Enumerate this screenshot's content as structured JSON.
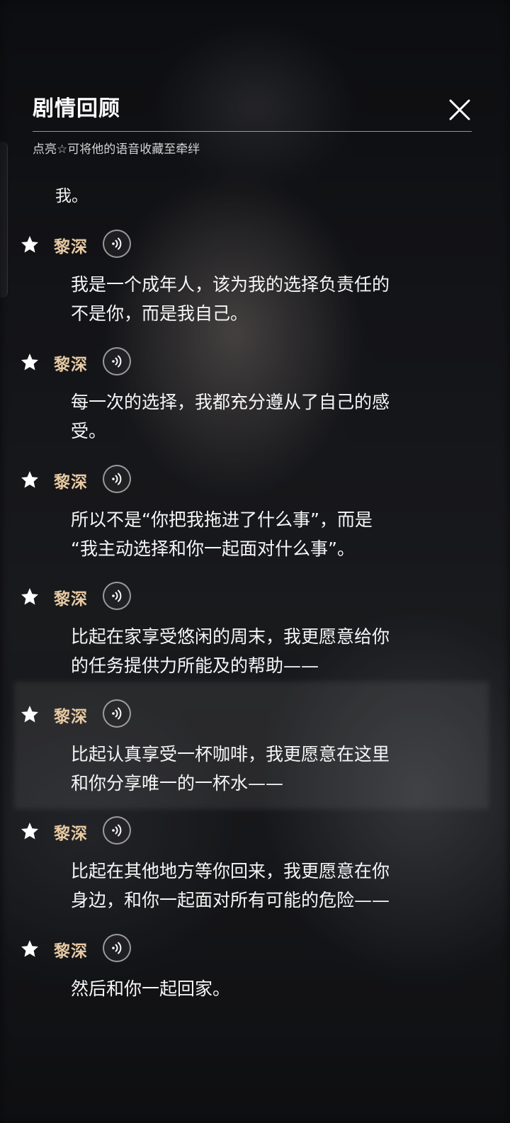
{
  "panel": {
    "title": "剧情回顾",
    "subtitle": "点亮☆可将他的语音收藏至牵绊",
    "first_line": "我。"
  },
  "icons": {
    "close": "close-icon",
    "star": "star-icon",
    "audio": "audio-icon"
  },
  "colors": {
    "speaker": "#e8caa3",
    "text": "#f6f6f6"
  },
  "entries": [
    {
      "speaker": "黎深",
      "line1": "我是一个成年人，该为我的选择负责任的",
      "line2": "不是你，而是我自己。"
    },
    {
      "speaker": "黎深",
      "line1": "每一次的选择，我都充分遵从了自己的感",
      "line2": "受。"
    },
    {
      "speaker": "黎深",
      "line1": "所以不是“你把我拖进了什么事”，而是",
      "line2": "“我主动选择和你一起面对什么事”。"
    },
    {
      "speaker": "黎深",
      "line1": "比起在家享受悠闲的周末，我更愿意给你",
      "line2": "的任务提供力所能及的帮助——"
    },
    {
      "speaker": "黎深",
      "line1": "比起认真享受一杯咖啡，我更愿意在这里",
      "line2": "和你分享唯一的一杯水——"
    },
    {
      "speaker": "黎深",
      "line1": "比起在其他地方等你回来，我更愿意在你",
      "line2": "身边，和你一起面对所有可能的危险——"
    },
    {
      "speaker": "黎深",
      "line1": "然后和你一起回家。",
      "line2": ""
    }
  ]
}
